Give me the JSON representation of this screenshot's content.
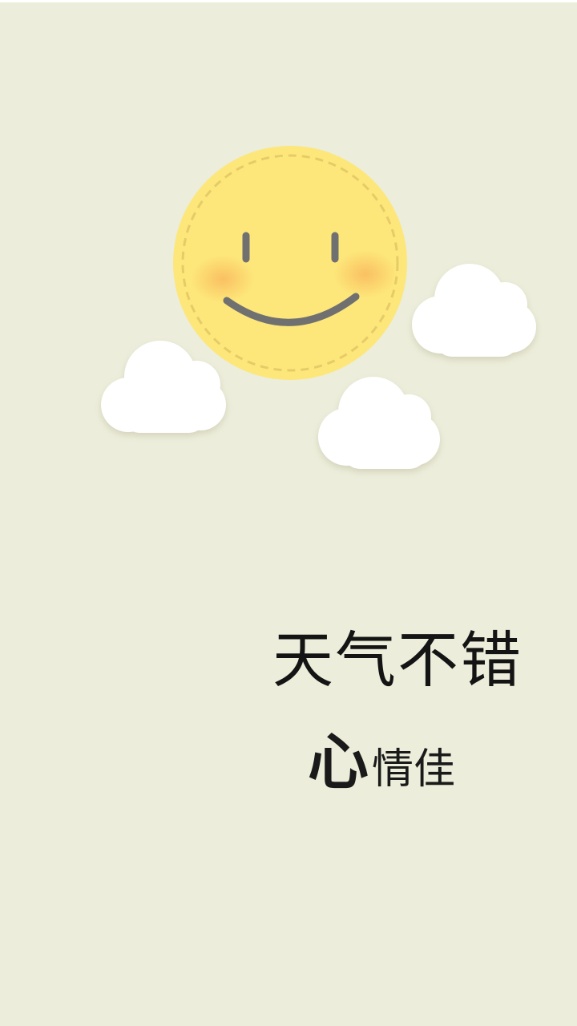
{
  "wallpaper": {
    "background_color": "#ecedda",
    "sun_color": "#fde77a",
    "cloud_color": "#ffffff"
  },
  "text": {
    "headline": "天气不错",
    "subline_big": "心",
    "subline_small": "情佳"
  }
}
